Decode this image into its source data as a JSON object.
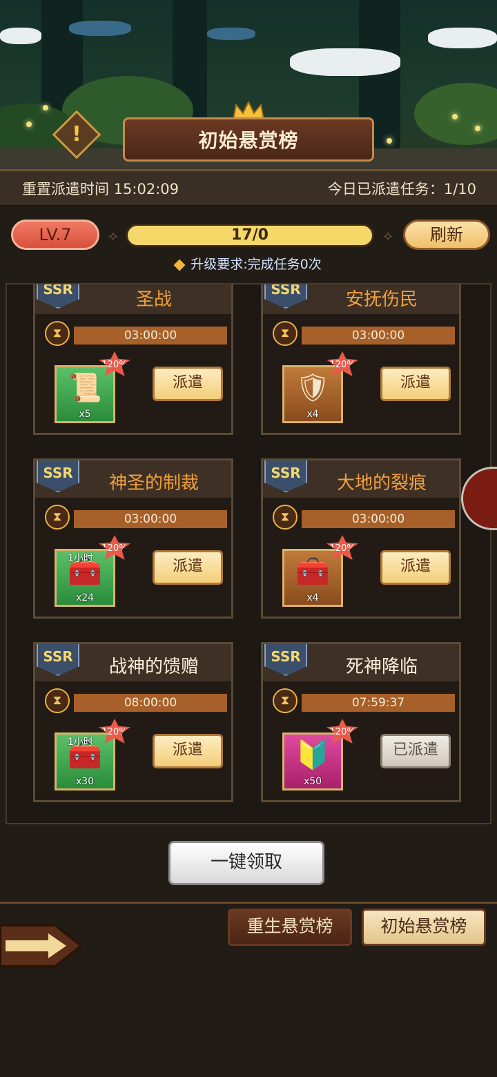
{
  "header": {
    "title": "初始悬赏榜"
  },
  "info": {
    "reset_label": "重置派遣时间 15:02:09",
    "daily_label": "今日已派遣任务：1/10"
  },
  "level": {
    "badge": "LV.7",
    "progress": "17/0",
    "refresh": "刷新",
    "requirement": "升级要求:完成任务0次"
  },
  "missions": [
    {
      "rank": "SSR",
      "title": "圣战",
      "title_color": "#f0a040",
      "timer": "03:00:00",
      "item_icon": "scroll-icon",
      "item_bg": "green",
      "qty": "x5",
      "duration": "",
      "bonus": "120%",
      "button": "派遣",
      "dispatched": false
    },
    {
      "rank": "SSR",
      "title": "安抚伤民",
      "title_color": "#f0a040",
      "timer": "03:00:00",
      "item_icon": "armor-icon",
      "item_bg": "brown",
      "qty": "x4",
      "duration": "",
      "bonus": "120%",
      "button": "派遣",
      "dispatched": false
    },
    {
      "rank": "SSR",
      "title": "神圣的制裁",
      "title_color": "#f0a040",
      "timer": "03:00:00",
      "item_icon": "treasure-chest-icon",
      "item_bg": "green",
      "qty": "x24",
      "duration": "1小时",
      "bonus": "120%",
      "button": "派遣",
      "dispatched": false
    },
    {
      "rank": "SSR",
      "title": "大地的裂痕",
      "title_color": "#f0a040",
      "timer": "03:00:00",
      "item_icon": "red-chest-icon",
      "item_bg": "brown",
      "qty": "x4",
      "duration": "",
      "bonus": "120%",
      "button": "派遣",
      "dispatched": false
    },
    {
      "rank": "SSR",
      "title": "战神的馈赠",
      "title_color": "#fff2de",
      "timer": "08:00:00",
      "item_icon": "crystal-chest-icon",
      "item_bg": "green",
      "qty": "x30",
      "duration": "1小时",
      "bonus": "120%",
      "button": "派遣",
      "dispatched": false
    },
    {
      "rank": "SSR",
      "title": "死神降临",
      "title_color": "#fff2de",
      "timer": "07:59:37",
      "item_icon": "emblem-icon",
      "item_bg": "pink",
      "qty": "x50",
      "duration": "",
      "bonus": "120%",
      "button": "已派遣",
      "dispatched": true
    }
  ],
  "footer": {
    "claim_all": "一键领取",
    "tab_rebirth": "重生悬赏榜",
    "tab_initial": "初始悬赏榜"
  }
}
